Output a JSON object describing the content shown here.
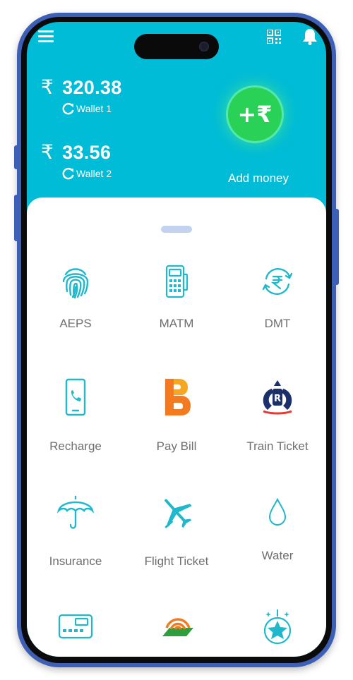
{
  "header": {
    "menu_icon": "hamburger-menu-icon",
    "qr_icon": "qr-code-icon",
    "bell_icon": "notification-bell-icon"
  },
  "wallets": [
    {
      "currency_symbol": "₹",
      "amount": "320.38",
      "label": "Wallet 1"
    },
    {
      "currency_symbol": "₹",
      "amount": "33.56",
      "label": "Wallet 2"
    }
  ],
  "add_money": {
    "button_text": "+₹",
    "label": "Add money",
    "color": "#29d157"
  },
  "colors": {
    "header_bg": "#00bcd6",
    "phone_frame": "#3d5fb6",
    "icon_teal": "#1fb8cc",
    "label_gray": "#6f6f6f"
  },
  "services": [
    {
      "label": "AEPS",
      "icon": "fingerprint-icon"
    },
    {
      "label": "MATM",
      "icon": "card-machine-icon"
    },
    {
      "label": "DMT",
      "icon": "rupee-transfer-icon"
    },
    {
      "label": "Recharge",
      "icon": "mobile-phone-icon"
    },
    {
      "label": "Pay Bill",
      "icon": "bharat-billpay-icon"
    },
    {
      "label": "Train Ticket",
      "icon": "irctc-train-icon"
    },
    {
      "label": "Insurance",
      "icon": "umbrella-icon"
    },
    {
      "label": "Flight Ticket",
      "icon": "airplane-icon"
    },
    {
      "label": "Water",
      "icon": "water-drop-icon"
    },
    {
      "label": "",
      "icon": "credit-card-icon"
    },
    {
      "label": "",
      "icon": "fastag-icon"
    },
    {
      "label": "",
      "icon": "star-rewards-icon"
    }
  ]
}
